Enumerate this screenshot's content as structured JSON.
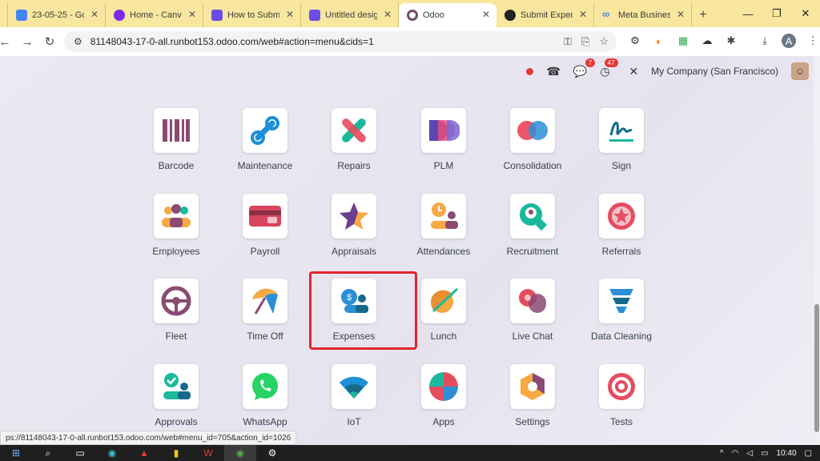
{
  "browser": {
    "tabs": [
      {
        "label": "23-05-25 - Go",
        "icon": "google-docs-icon",
        "color": "#4285f4"
      },
      {
        "label": "Home - Canva",
        "icon": "canva-icon",
        "color": "#7d2ae8"
      },
      {
        "label": "How to Submi",
        "icon": "bookmark-icon",
        "color": "#6b4de6"
      },
      {
        "label": "Untitled desig",
        "icon": "bookmark-icon",
        "color": "#6b4de6"
      },
      {
        "label": "Odoo",
        "icon": "odoo-icon",
        "color": "#714b67"
      },
      {
        "label": "Submit Expen",
        "icon": "chatgpt-icon",
        "color": "#222222"
      },
      {
        "label": "Meta Busines",
        "icon": "meta-icon",
        "color": "#0866ff"
      }
    ],
    "new_tab": "+",
    "url": "81148043-17-0-all.runbot153.odoo.com/web#action=menu&cids=1",
    "status_url": "ps://81148043-17-0-all.runbot153.odoo.com/web#menu_id=705&action_id=1026"
  },
  "systray": {
    "messages_count": "7",
    "activities_count": "47",
    "company": "My Company (San Francisco)"
  },
  "apps": [
    {
      "label": "Barcode",
      "icon": "barcode-icon"
    },
    {
      "label": "Maintenance",
      "icon": "maintenance-icon"
    },
    {
      "label": "Repairs",
      "icon": "repairs-icon"
    },
    {
      "label": "PLM",
      "icon": "plm-icon"
    },
    {
      "label": "Consolidation",
      "icon": "consolidation-icon"
    },
    {
      "label": "Sign",
      "icon": "sign-icon"
    },
    {
      "label": "Employees",
      "icon": "employees-icon"
    },
    {
      "label": "Payroll",
      "icon": "payroll-icon"
    },
    {
      "label": "Appraisals",
      "icon": "appraisals-icon"
    },
    {
      "label": "Attendances",
      "icon": "attendances-icon"
    },
    {
      "label": "Recruitment",
      "icon": "recruitment-icon"
    },
    {
      "label": "Referrals",
      "icon": "referrals-icon"
    },
    {
      "label": "Fleet",
      "icon": "fleet-icon"
    },
    {
      "label": "Time Off",
      "icon": "time-off-icon"
    },
    {
      "label": "Expenses",
      "icon": "expenses-icon"
    },
    {
      "label": "Lunch",
      "icon": "lunch-icon"
    },
    {
      "label": "Live Chat",
      "icon": "live-chat-icon"
    },
    {
      "label": "Data Cleaning",
      "icon": "data-cleaning-icon"
    },
    {
      "label": "Approvals",
      "icon": "approvals-icon"
    },
    {
      "label": "WhatsApp",
      "icon": "whatsapp-icon"
    },
    {
      "label": "IoT",
      "icon": "iot-icon"
    },
    {
      "label": "Apps",
      "icon": "apps-icon"
    },
    {
      "label": "Settings",
      "icon": "settings-icon"
    },
    {
      "label": "Tests",
      "icon": "tests-icon"
    }
  ],
  "highlighted_app": "Expenses",
  "taskbar": {
    "time": "10:40"
  },
  "colors": {
    "highlight": "#e0262c",
    "tabstrip": "#f9e79f",
    "odoo_purple": "#714b67"
  }
}
